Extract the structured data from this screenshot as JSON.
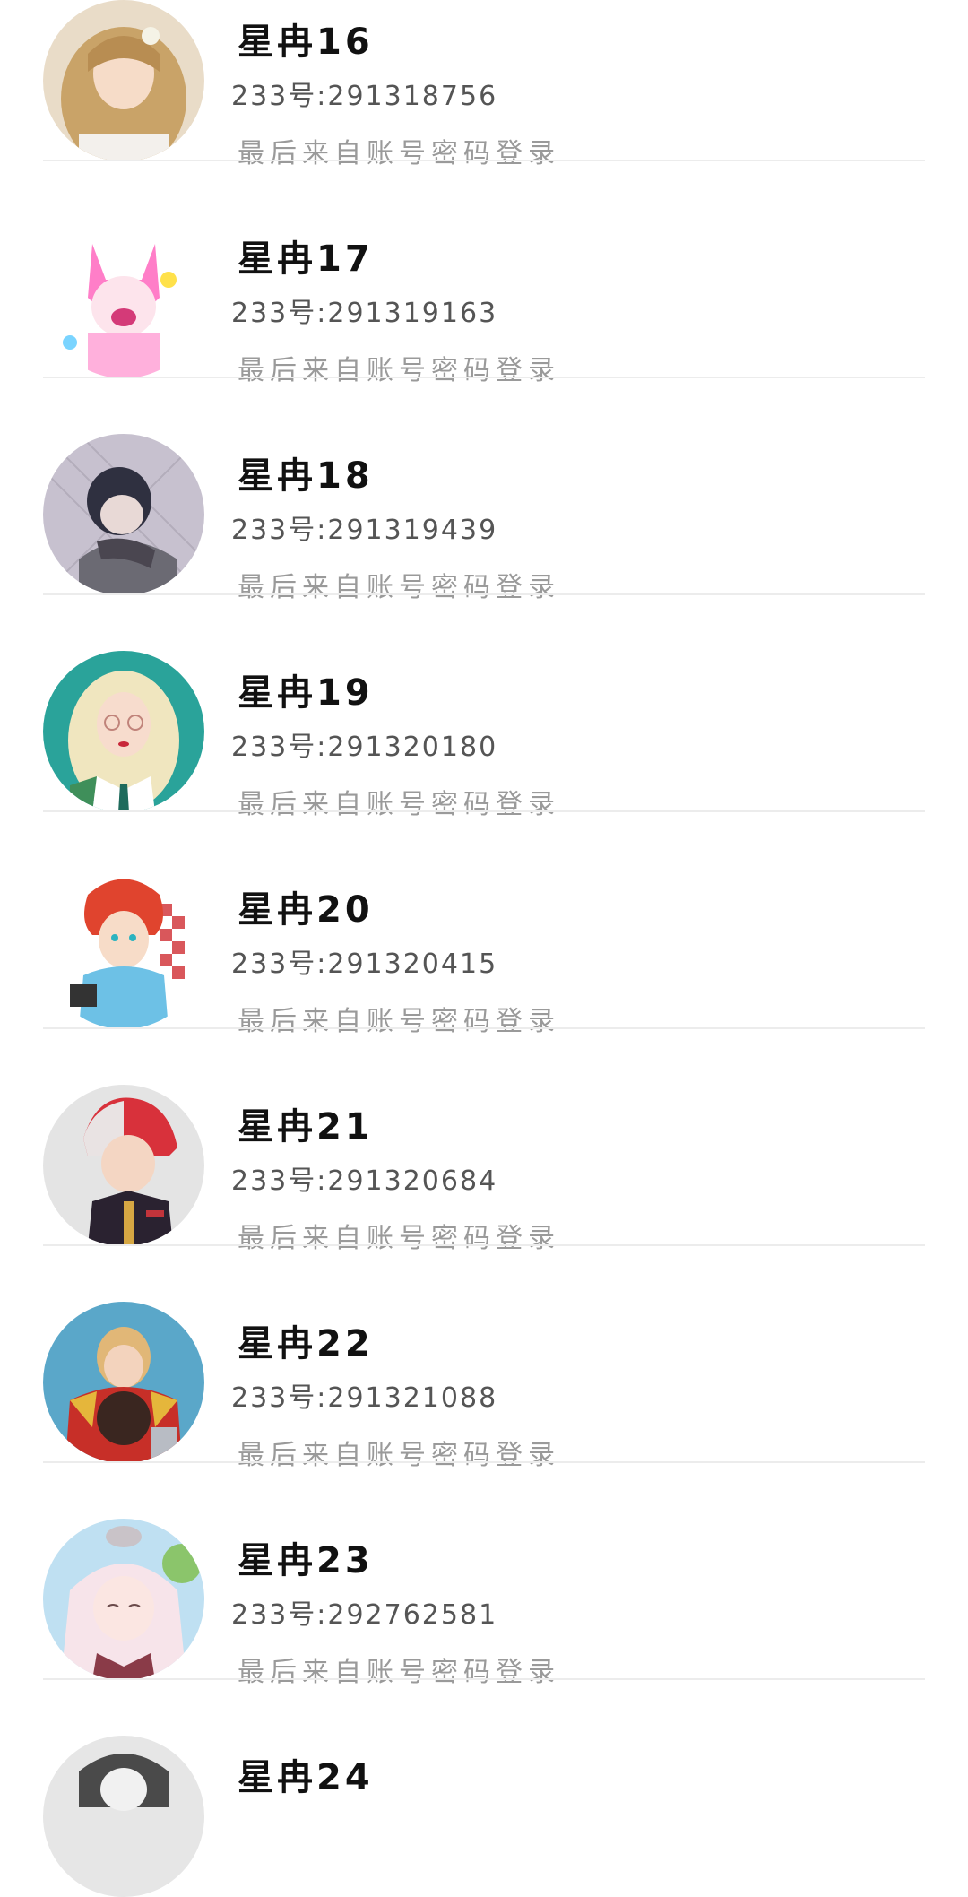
{
  "accounts": [
    {
      "name": "星冉16",
      "uid_label": "233号:",
      "uid": "291318756",
      "login_source": "最后来自账号密码登录"
    },
    {
      "name": "星冉17",
      "uid_label": "233号:",
      "uid": "291319163",
      "login_source": "最后来自账号密码登录"
    },
    {
      "name": "星冉18",
      "uid_label": "233号:",
      "uid": "291319439",
      "login_source": "最后来自账号密码登录"
    },
    {
      "name": "星冉19",
      "uid_label": "233号:",
      "uid": "291320180",
      "login_source": "最后来自账号密码登录"
    },
    {
      "name": "星冉20",
      "uid_label": "233号:",
      "uid": "291320415",
      "login_source": "最后来自账号密码登录"
    },
    {
      "name": "星冉21",
      "uid_label": "233号:",
      "uid": "291320684",
      "login_source": "最后来自账号密码登录"
    },
    {
      "name": "星冉22",
      "uid_label": "233号:",
      "uid": "291321088",
      "login_source": "最后来自账号密码登录"
    },
    {
      "name": "星冉23",
      "uid_label": "233号:",
      "uid": "292762581",
      "login_source": "最后来自账号密码登录"
    },
    {
      "name": "星冉24",
      "uid_label": "",
      "uid": "",
      "login_source": ""
    }
  ],
  "colors": {
    "name": "#111111",
    "uid": "#555555",
    "login_source": "#9a9a9a",
    "divider": "#ececec"
  }
}
